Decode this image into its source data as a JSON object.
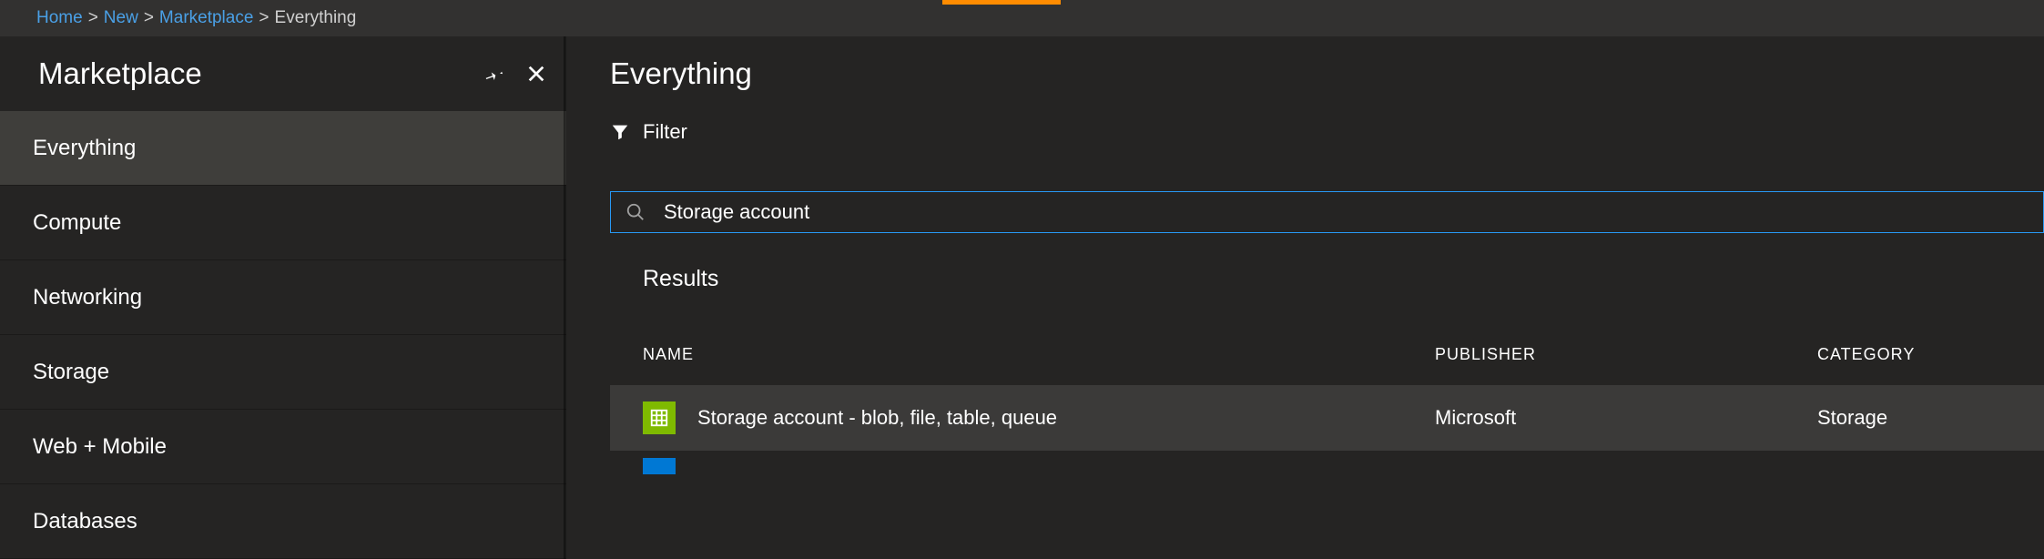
{
  "breadcrumb": {
    "items": [
      {
        "label": "Home"
      },
      {
        "label": "New"
      },
      {
        "label": "Marketplace"
      }
    ],
    "current": "Everything"
  },
  "leftBlade": {
    "title": "Marketplace",
    "menu": [
      {
        "label": "Everything",
        "selected": true
      },
      {
        "label": "Compute",
        "selected": false
      },
      {
        "label": "Networking",
        "selected": false
      },
      {
        "label": "Storage",
        "selected": false
      },
      {
        "label": "Web + Mobile",
        "selected": false
      },
      {
        "label": "Databases",
        "selected": false
      }
    ]
  },
  "rightBlade": {
    "title": "Everything",
    "filterLabel": "Filter",
    "searchValue": "Storage account",
    "resultsLabel": "Results",
    "columns": {
      "name": "NAME",
      "publisher": "PUBLISHER",
      "category": "CATEGORY"
    },
    "rows": [
      {
        "name": "Storage account - blob, file, table, queue",
        "publisher": "Microsoft",
        "category": "Storage",
        "iconColor": "#7fba00"
      }
    ]
  }
}
